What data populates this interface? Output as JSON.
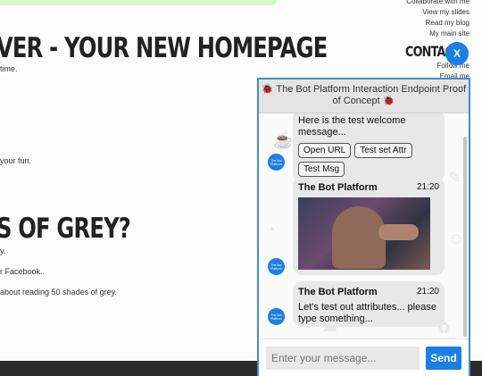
{
  "page": {
    "title": "VER - YOUR NEW HOMEPAGE",
    "line1": "time.",
    "line2": "your fun.",
    "subtitle": "S OF GREY?",
    "line3": "y.",
    "line4": "r Facebook..",
    "line5": "about reading 50 shades of grey.",
    "side_links": [
      "Collaborate with me",
      "View my slides",
      "Read my blog",
      "My main site"
    ],
    "contact_heading": "CONTACT",
    "follow_links": [
      "Follow me",
      "Email me"
    ]
  },
  "chat": {
    "close_label": "X",
    "title": "🐞 The Bot Platform Interaction Endpoint Proof of Concept 🐞",
    "avatar_label": "The Bot Platform",
    "messages": {
      "welcome": {
        "text": "Here is the test welcome message...",
        "buttons": [
          "Open URL",
          "Test set Attr",
          "Test Msg"
        ]
      },
      "gif_msg": {
        "sender": "The Bot Platform",
        "time": "21:20"
      },
      "attr_msg": {
        "sender": "The Bot Platform",
        "time": "21:20",
        "text": "Let's test out attributes... please type something..."
      }
    },
    "input_placeholder": "Enter your message...",
    "send_label": "Send",
    "accent_color": "#1a7fe8"
  }
}
